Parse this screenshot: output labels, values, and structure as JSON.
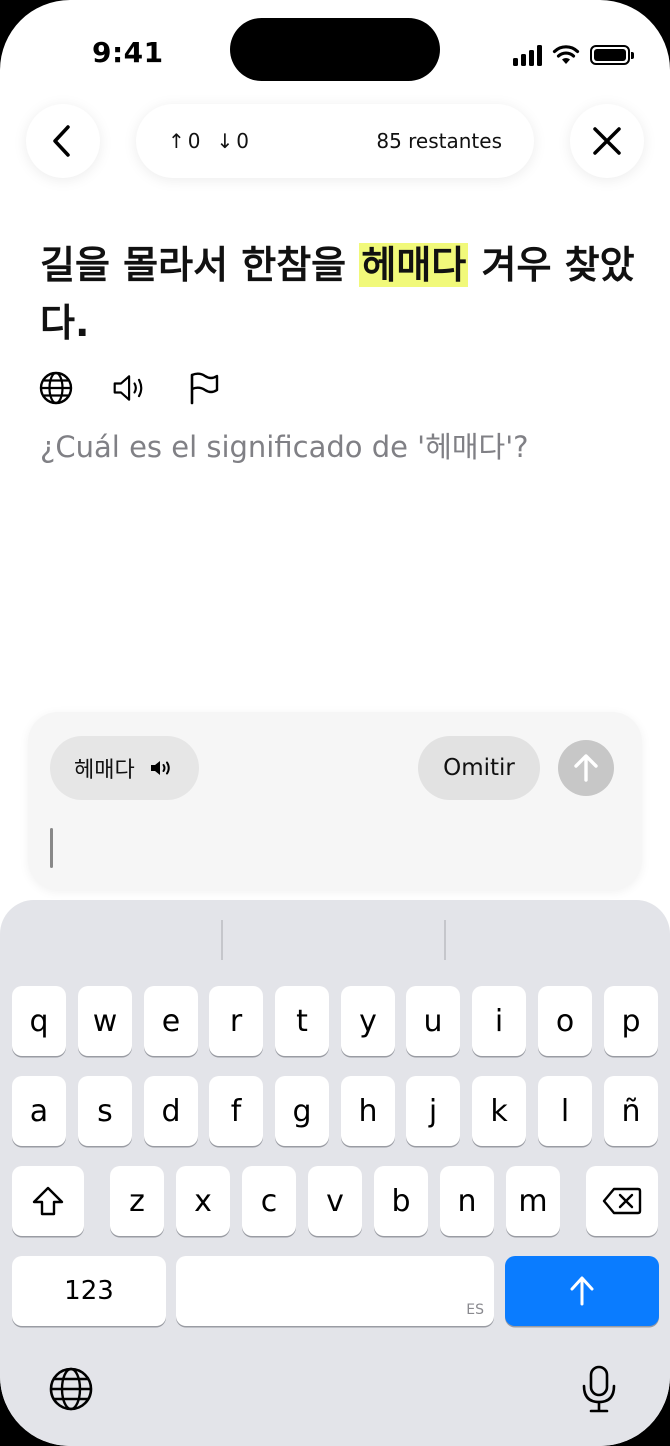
{
  "status": {
    "time": "9:41"
  },
  "header": {
    "up_count": "0",
    "down_count": "0",
    "remaining": "85 restantes"
  },
  "sentence": {
    "before": "길을 몰라서 한참을 ",
    "highlight": "헤매다",
    "after": " 겨우 찾았다."
  },
  "question": "¿Cuál es el significado de '헤매다'?",
  "answer": {
    "word": "헤매다",
    "skip_label": "Omitir",
    "value": "",
    "placeholder": ""
  },
  "keyboard": {
    "row1": [
      "q",
      "w",
      "e",
      "r",
      "t",
      "y",
      "u",
      "i",
      "o",
      "p"
    ],
    "row2": [
      "a",
      "s",
      "d",
      "f",
      "g",
      "h",
      "j",
      "k",
      "l",
      "ñ"
    ],
    "row3": [
      "z",
      "x",
      "c",
      "v",
      "b",
      "n",
      "m"
    ],
    "numbers_label": "123",
    "space_lang": "ES"
  },
  "colors": {
    "highlight": "#f1f97a",
    "accent": "#0a7cff"
  }
}
